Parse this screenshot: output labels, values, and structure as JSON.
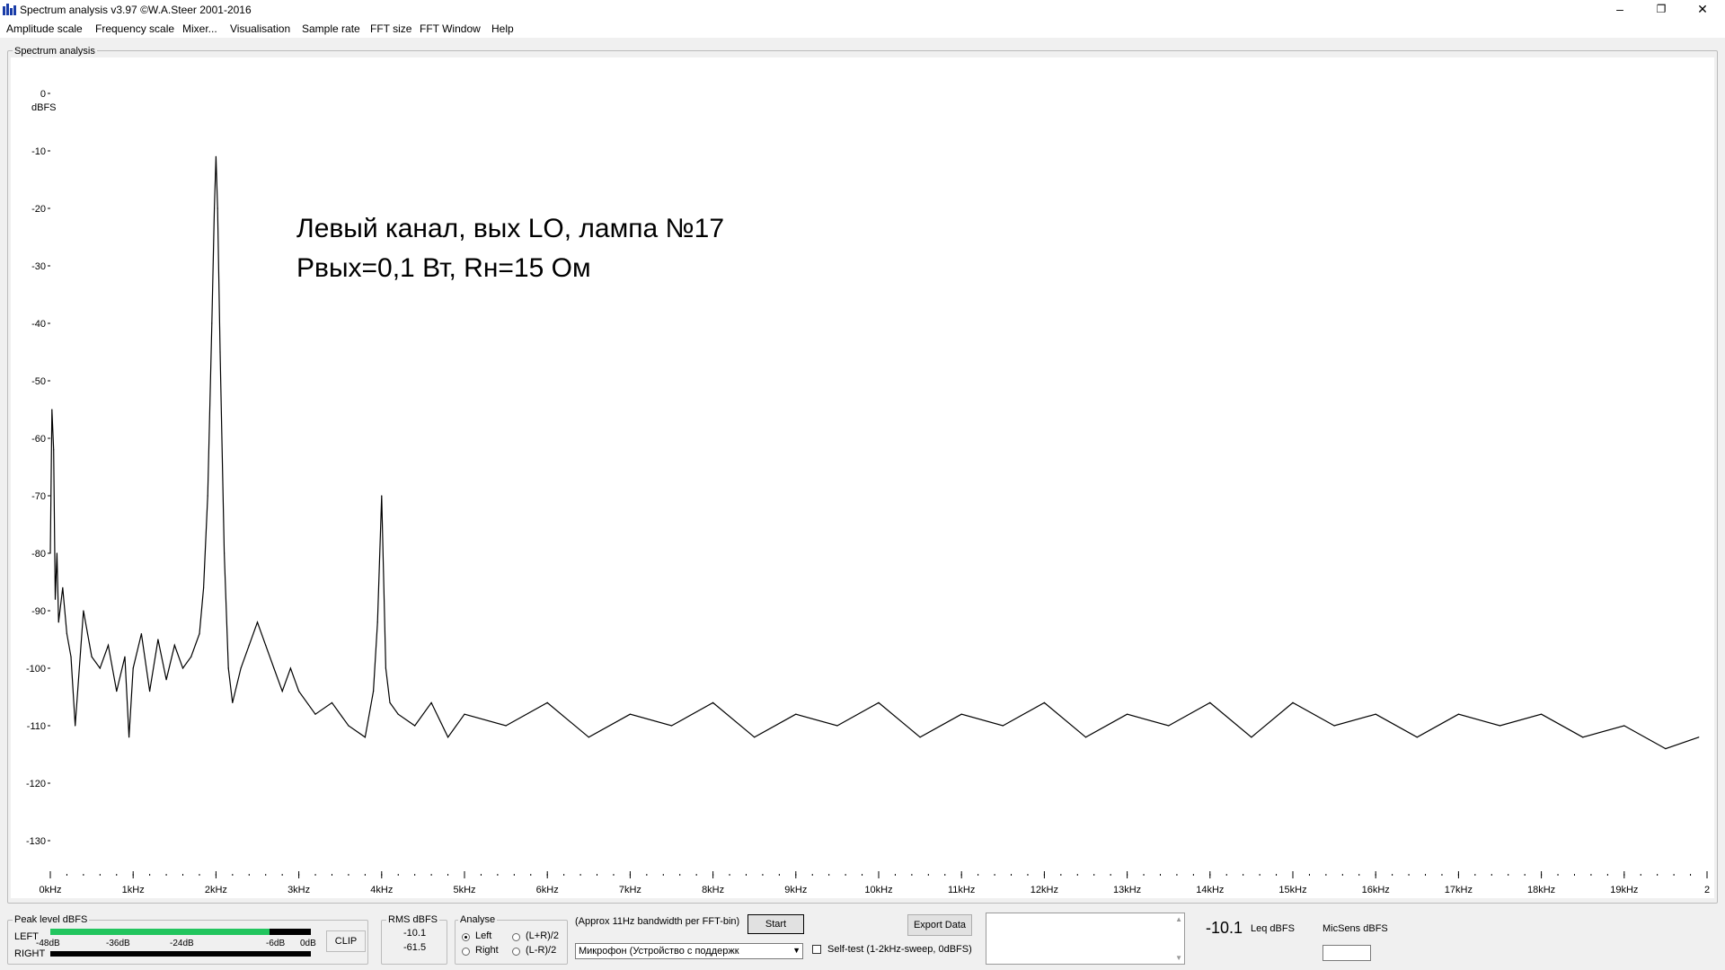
{
  "window": {
    "title": "Spectrum analysis v3.97  ©W.A.Steer 2001-2016",
    "minimize_glyph": "–",
    "restore_glyph": "❐",
    "close_glyph": "✕"
  },
  "menu": [
    "Amplitude scale",
    "Frequency scale",
    "Mixer...",
    "Visualisation",
    "Sample rate",
    "FFT size",
    "FFT Window",
    "Help"
  ],
  "group_label": "Spectrum analysis",
  "annotation": {
    "line1": "Левый канал, вых LO, лампа №17",
    "line2": "Рвых=0,1 Вт, Rн=15 Ом"
  },
  "chart_data": {
    "type": "line",
    "title": "",
    "xlabel": "",
    "ylabel": "dBFS",
    "ylim": [
      -135,
      0
    ],
    "xlim": [
      0,
      20000
    ],
    "y_ticks": [
      0,
      -10,
      -20,
      -30,
      -40,
      -50,
      -60,
      -70,
      -80,
      -90,
      -100,
      -110,
      -120,
      -130
    ],
    "x_ticks": [
      0,
      1000,
      2000,
      3000,
      4000,
      5000,
      6000,
      7000,
      8000,
      9000,
      10000,
      11000,
      12000,
      13000,
      14000,
      15000,
      16000,
      17000,
      18000,
      19000,
      20000
    ],
    "x_tick_labels": [
      "0kHz",
      "1kHz",
      "2kHz",
      "3kHz",
      "4kHz",
      "5kHz",
      "6kHz",
      "7kHz",
      "8kHz",
      "9kHz",
      "10kHz",
      "11kHz",
      "12kHz",
      "13kHz",
      "14kHz",
      "15kHz",
      "16kHz",
      "17kHz",
      "18kHz",
      "19kHz",
      "2"
    ],
    "series": [
      {
        "x": [
          0,
          20,
          40,
          60,
          80,
          100,
          150,
          200,
          250,
          300,
          400,
          500,
          600,
          700,
          800,
          900,
          950,
          1000,
          1100,
          1200,
          1300,
          1400,
          1500,
          1600,
          1700,
          1800,
          1850,
          1900,
          1950,
          1980,
          2000,
          2020,
          2050,
          2100,
          2150,
          2200,
          2300,
          2400,
          2500,
          2600,
          2700,
          2800,
          2900,
          3000,
          3200,
          3400,
          3600,
          3800,
          3900,
          3950,
          4000,
          4050,
          4100,
          4200,
          4400,
          4600,
          4800,
          5000,
          5500,
          6000,
          6500,
          7000,
          7500,
          8000,
          8500,
          9000,
          9500,
          10000,
          10500,
          11000,
          11500,
          12000,
          12500,
          13000,
          13500,
          14000,
          14500,
          15000,
          15500,
          16000,
          16500,
          17000,
          17500,
          18000,
          18500,
          19000,
          19500,
          19900
        ],
        "y": [
          -80,
          -55,
          -62,
          -88,
          -80,
          -92,
          -86,
          -94,
          -98,
          -110,
          -90,
          -98,
          -100,
          -96,
          -104,
          -98,
          -112,
          -100,
          -94,
          -104,
          -95,
          -102,
          -96,
          -100,
          -98,
          -94,
          -86,
          -70,
          -40,
          -20,
          -11,
          -20,
          -45,
          -80,
          -100,
          -106,
          -100,
          -96,
          -92,
          -96,
          -100,
          -104,
          -100,
          -104,
          -108,
          -106,
          -110,
          -112,
          -104,
          -92,
          -70,
          -100,
          -106,
          -108,
          -110,
          -106,
          -112,
          -108,
          -110,
          -106,
          -112,
          -108,
          -110,
          -106,
          -112,
          -108,
          -110,
          -106,
          -112,
          -108,
          -110,
          -106,
          -112,
          -108,
          -110,
          -106,
          -112,
          -106,
          -110,
          -108,
          -112,
          -108,
          -110,
          -108,
          -112,
          -110,
          -114,
          -112
        ]
      }
    ]
  },
  "peak": {
    "label": "Peak level dBFS",
    "left": "LEFT",
    "right": "RIGHT",
    "scale": [
      "-48dB",
      "-36dB",
      "-24dB",
      "-6dB",
      "0dB"
    ],
    "left_level": 0.84,
    "right_level": 0.0,
    "clip": "CLIP"
  },
  "rms": {
    "label": "RMS dBFS",
    "left": "-10.1",
    "right": "-61.5"
  },
  "analyse": {
    "label": "Analyse",
    "options": [
      "Left",
      "Right",
      "(L+R)/2",
      "(L-R)/2"
    ],
    "selected": "Left"
  },
  "bandwidth_note": "(Approx 11Hz bandwidth per FFT-bin)",
  "start_button": "Start",
  "device_select": "Микрофон (Устройство с поддержк",
  "export_button": "Export Data",
  "selftest": {
    "checked": false,
    "label": "Self-test  (1-2kHz-sweep, 0dBFS)"
  },
  "leq": {
    "value": "-10.1",
    "unit": "Leq dBFS"
  },
  "micsens": {
    "label": "MicSens dBFS",
    "value": ""
  }
}
